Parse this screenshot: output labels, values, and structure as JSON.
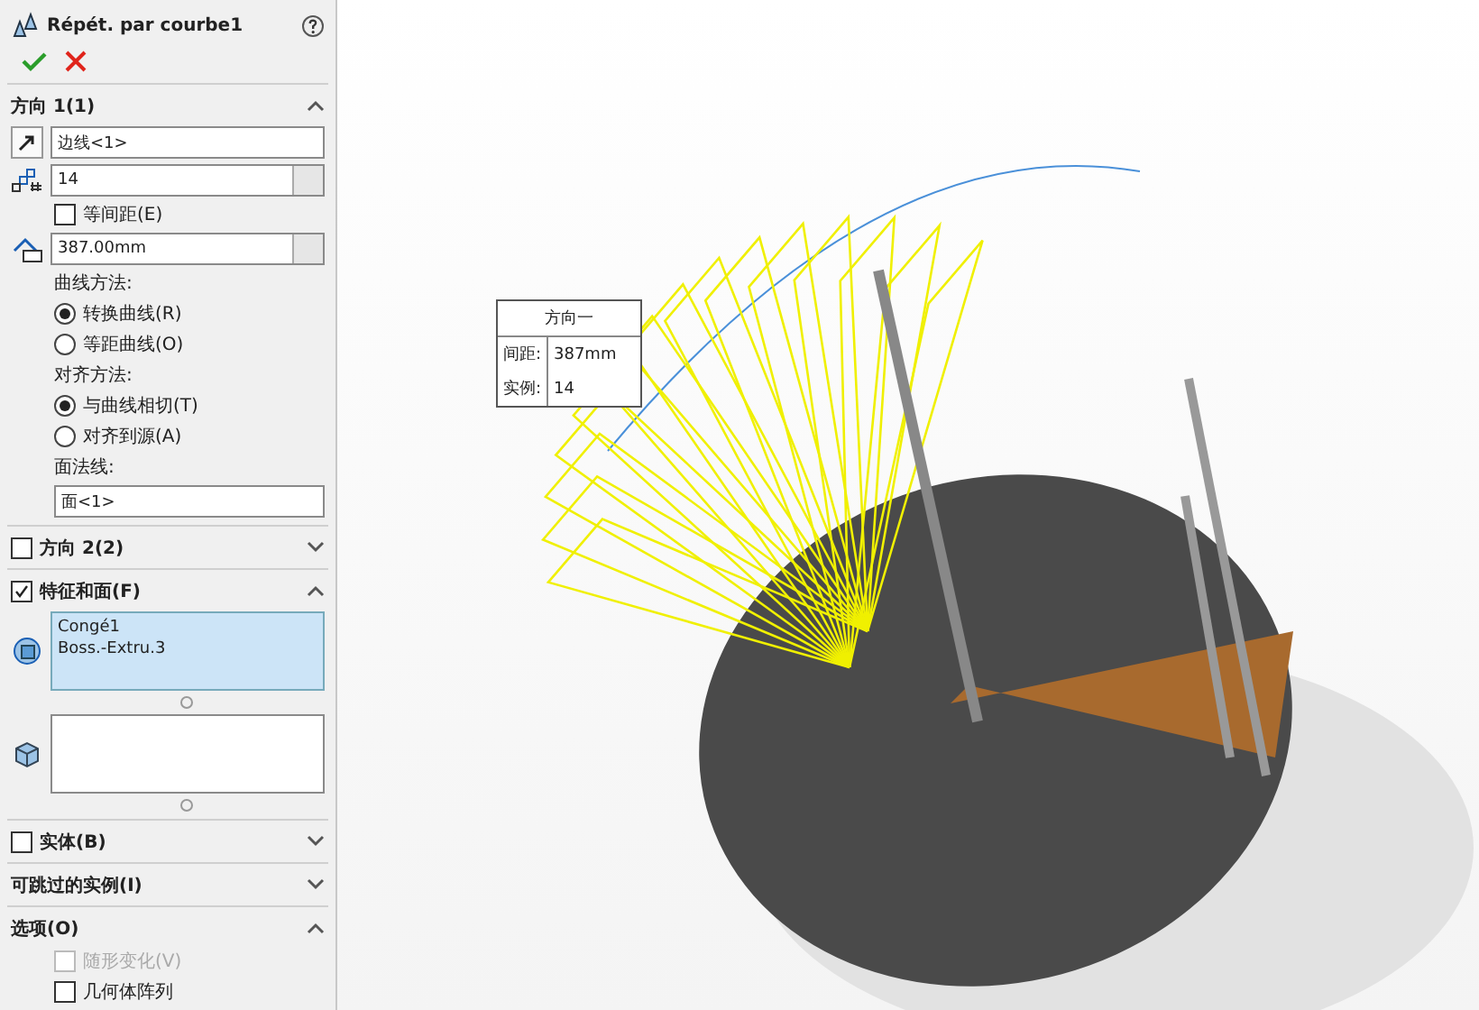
{
  "panel": {
    "title": "Répét. par courbe1",
    "sections": [
      {
        "title": "方向 1(1)",
        "expanded": true,
        "items": [
          {
            "kind": "select",
            "value": "边线<1>"
          },
          {
            "kind": "count-spin",
            "value": "14"
          },
          {
            "kind": "checkbox",
            "label": "等间距(E)",
            "checked": false,
            "disabled": false
          },
          {
            "kind": "distance-spin",
            "value": "387.00mm"
          },
          {
            "kind": "caption",
            "text": "曲线方法:"
          },
          {
            "kind": "radio",
            "label": "转换曲线(R)",
            "selected": true
          },
          {
            "kind": "radio",
            "label": "等距曲线(O)",
            "selected": false
          },
          {
            "kind": "caption",
            "text": "对齐方法:"
          },
          {
            "kind": "radio",
            "label": "与曲线相切(T)",
            "selected": true
          },
          {
            "kind": "radio",
            "label": "对齐到源(A)",
            "selected": false
          },
          {
            "kind": "caption",
            "text": "面法线:"
          },
          {
            "kind": "text",
            "value": "面<1>"
          }
        ]
      },
      {
        "title": "方向 2(2)",
        "checked": false,
        "expanded": false
      },
      {
        "title": "特征和面(F)",
        "checked": true,
        "expanded": true,
        "items": [
          {
            "kind": "feature-listbox",
            "entries": [
              "Congé1",
              "Boss.-Extru.3"
            ],
            "selected": true
          },
          {
            "kind": "body-listbox",
            "selected": false
          }
        ]
      },
      {
        "title": "实体(B)",
        "checked": false,
        "expanded": false
      },
      {
        "title": "可跳过的实例(I)",
        "expanded": false
      },
      {
        "title": "选项(O)",
        "expanded": true,
        "items": [
          {
            "kind": "checkbox",
            "label": "随形变化(V)",
            "checked": false,
            "disabled": true
          },
          {
            "kind": "checkbox",
            "label": "几何体阵列",
            "checked": false,
            "disabled": false
          }
        ]
      }
    ]
  },
  "callout": {
    "title": "方向一",
    "rows": [
      {
        "label": "间距:",
        "value": "387mm"
      },
      {
        "label": "实例:",
        "value": "14"
      }
    ]
  }
}
